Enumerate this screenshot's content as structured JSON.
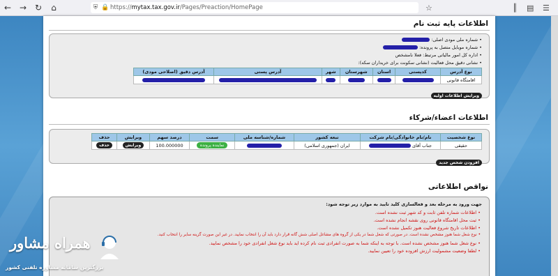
{
  "browser": {
    "url_prefix": "https://",
    "url_domain": "mytax.tax.gov.ir",
    "url_path": "/Pages/Preaction/HomePage"
  },
  "basic_info": {
    "title": "اطلاعات پایه ثبت نام",
    "bullets": [
      "شماره ملی مودی اصلی:",
      "شماره موبایل متصل به پرونده:",
      "اداره کل امور مالیاتی مرتبط: فعلا نامشخص",
      "نشانی دقیق محل فعالیت (نشانی سکونت برای خریداران سکه):"
    ],
    "table_headers": [
      "نوع آدرس",
      "کدپستی",
      "استان",
      "شهرستان",
      "شهر",
      "آدرس پستی",
      "آدرس دقیق (اصلاحی مودی)"
    ],
    "row_type": "اقامتگاه قانونی",
    "edit_button": "ویرایش اطلاعات اولیه"
  },
  "members": {
    "title": "اطلاعات اعضاء/شرکاء",
    "table_headers": [
      "نوع شخصیت",
      "نام/نام خانوادگی/نام شرکت",
      "تبعه کشور",
      "شماره/شناسه ملی",
      "سمت",
      "درصد سهم",
      "ویرایش",
      "حذف"
    ],
    "row": {
      "type": "حقیقی",
      "name_prefix": "جناب آقای",
      "country": "ایران (جمهوری اسلامی)",
      "role": "نماینده پرونده",
      "share": "100.000000",
      "edit": "ویرایش",
      "delete": "حذف"
    },
    "add_button": "افزودن شخص جدید"
  },
  "deficiencies": {
    "title": "نواقص اطلاعاتی",
    "intro": "جهت ورود به مرحله بعد و فعالسازی کلید تایید به موارد زیر توجه شود:",
    "items": [
      "اطلاعات شماره تلفن ثابت و کد شهر ثبت نشده است.",
      "ثبت محل اقامتگاه قانونی روی نقشه انجام نشده است.",
      "اطلاعات تاریخ شروع فعالیت هنوز تکمیل نشده است.",
      "نوع شغل شما هنوز مشخص نشده است. در صورتی که شغل شما در یکی از گروه های مشاغل اصلی شش گانه قرار دارد باید آن را انتخاب نمایید. در غیر این صورت گزینه سایر را انتخاب کنید.",
      "نوع شغل شما هنوز مشخص نشده است. با توجه به اینکه شما به صورت انفرادی ثبت نام کرده اید باید نوع شغل انفرادی خود را مشخص نمایید.",
      "لطفا وضعیت مشمولیت ارزش افزوده خود را تعیین نمایید."
    ]
  },
  "logo": {
    "main": "همراه مشاور",
    "sub": "بزرگترین سامانه مشاوره تلفنی کشور"
  }
}
